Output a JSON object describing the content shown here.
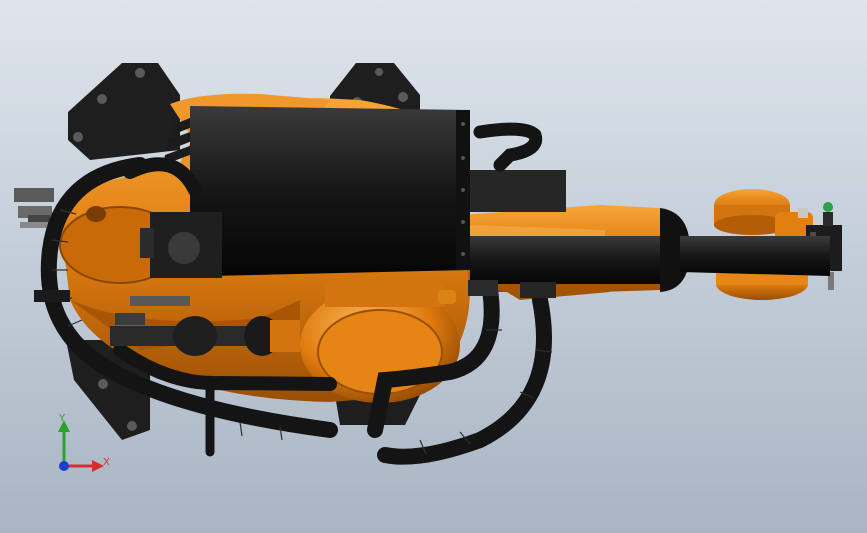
{
  "viewport": {
    "background_top": "#dfe5ec",
    "background_bottom": "#a9b5c3"
  },
  "model": {
    "body_color": "#e07d10",
    "body_highlight": "#f5a23a",
    "body_shadow": "#9a4f05",
    "hose_color": "#151515",
    "plate_color": "#1e1e1e"
  },
  "triad": {
    "y_label": "Y",
    "x_label": "X",
    "y_color": "#2fa02f",
    "x_color": "#d23030",
    "origin_color": "#1c3fd0"
  }
}
